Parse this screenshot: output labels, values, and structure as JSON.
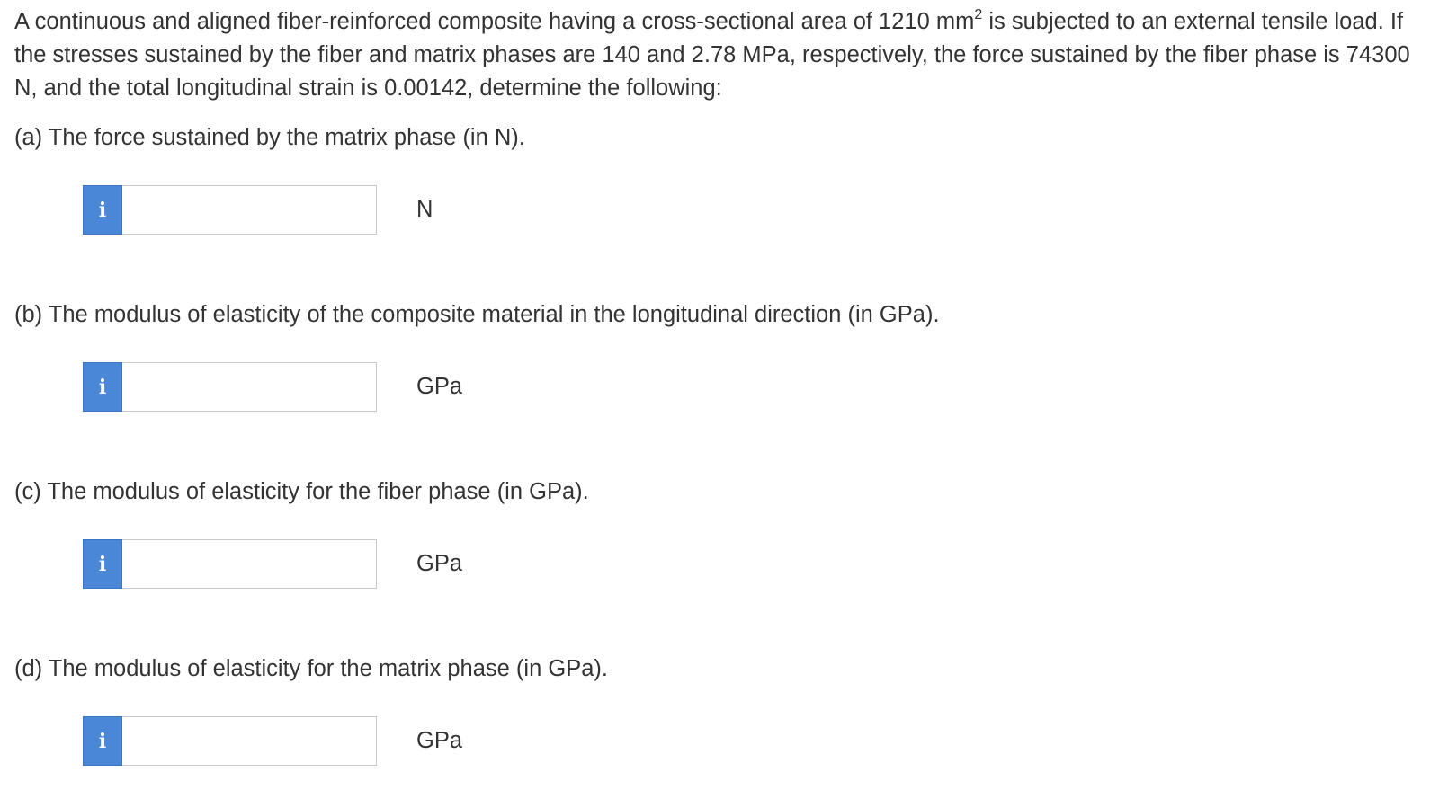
{
  "problem": {
    "text_before_sup": "A continuous and aligned fiber-reinforced composite having a cross-sectional area of 1210 mm",
    "sup": "2",
    "text_after_sup": " is subjected to an external tensile load. If the stresses sustained by the fiber and matrix phases are 140 and 2.78 MPa, respectively, the force sustained by the fiber phase is 74300 N, and the total longitudinal strain is 0.00142, determine the following:"
  },
  "questions": [
    {
      "prompt": "(a) The force sustained by the matrix phase (in N).",
      "info_icon": "i",
      "value": "",
      "unit": "N"
    },
    {
      "prompt": "(b) The modulus of elasticity of the composite material in the longitudinal direction (in GPa).",
      "info_icon": "i",
      "value": "",
      "unit": "GPa"
    },
    {
      "prompt": "(c) The modulus of elasticity for the fiber phase (in GPa).",
      "info_icon": "i",
      "value": "",
      "unit": "GPa"
    },
    {
      "prompt": "(d) The modulus of elasticity for the matrix phase (in GPa).",
      "info_icon": "i",
      "value": "",
      "unit": "GPa"
    }
  ],
  "colors": {
    "info_button": "#4a87d6",
    "text": "#333333",
    "input_border": "#c9c9c9"
  }
}
